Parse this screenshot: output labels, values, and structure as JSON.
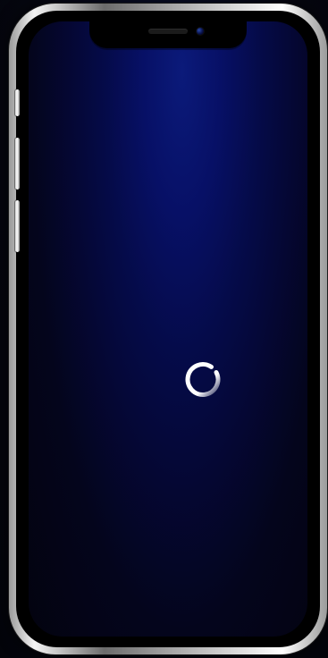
{
  "scene": {
    "description": "",
    "loading": true
  },
  "icons": {
    "spinner": "loading-spinner-icon",
    "camera": "front-camera-icon",
    "speaker": "earpiece-speaker-icon"
  },
  "colors": {
    "screen_top": "#0b1a7a",
    "screen_bottom": "#03030f",
    "spinner": "#ffffff",
    "frame": "#d9d9d9"
  }
}
